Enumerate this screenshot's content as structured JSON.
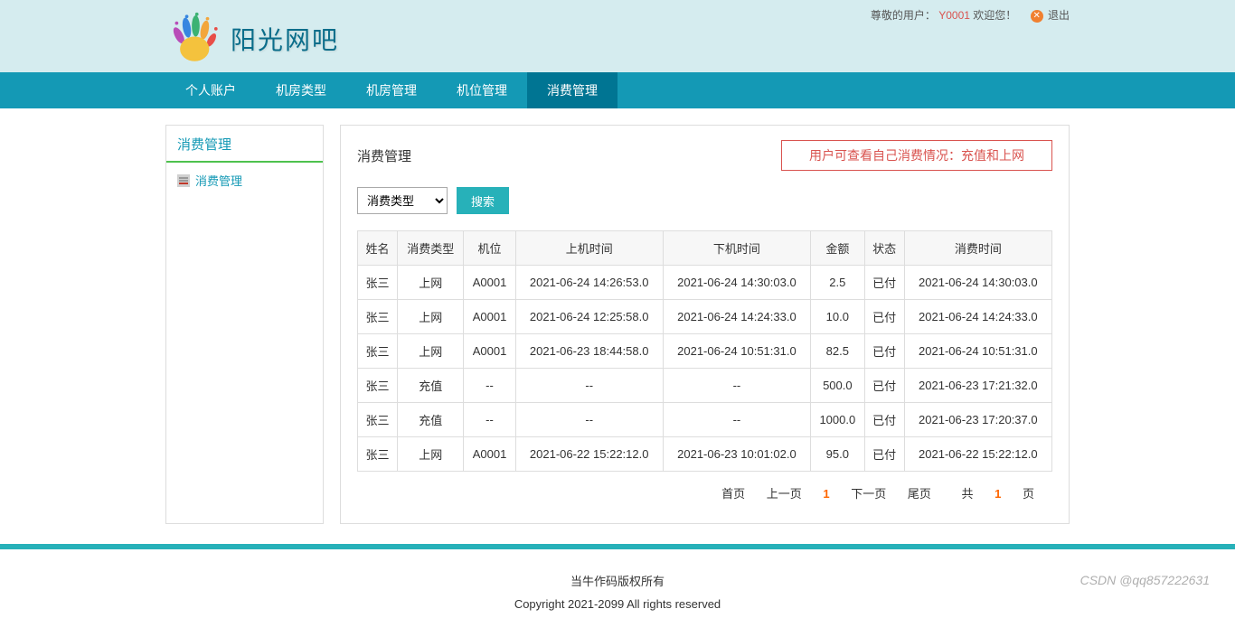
{
  "header": {
    "user_label": "尊敬的用户：",
    "username": "Y0001",
    "welcome": " 欢迎您！",
    "logout": "退出",
    "site_title": "阳光网吧"
  },
  "nav": {
    "items": [
      {
        "label": "个人账户"
      },
      {
        "label": "机房类型"
      },
      {
        "label": "机房管理"
      },
      {
        "label": "机位管理"
      },
      {
        "label": "消费管理",
        "active": true
      }
    ]
  },
  "sidebar": {
    "title": "消费管理",
    "items": [
      {
        "label": "消费管理"
      }
    ]
  },
  "content": {
    "title": "消费管理",
    "notice": "用户可查看自己消费情况：充值和上网",
    "select_placeholder": "消费类型",
    "search_btn": "搜索"
  },
  "table": {
    "headers": [
      "姓名",
      "消费类型",
      "机位",
      "上机时间",
      "下机时间",
      "金额",
      "状态",
      "消费时间"
    ],
    "rows": [
      [
        "张三",
        "上网",
        "A0001",
        "2021-06-24 14:26:53.0",
        "2021-06-24 14:30:03.0",
        "2.5",
        "已付",
        "2021-06-24 14:30:03.0"
      ],
      [
        "张三",
        "上网",
        "A0001",
        "2021-06-24 12:25:58.0",
        "2021-06-24 14:24:33.0",
        "10.0",
        "已付",
        "2021-06-24 14:24:33.0"
      ],
      [
        "张三",
        "上网",
        "A0001",
        "2021-06-23 18:44:58.0",
        "2021-06-24 10:51:31.0",
        "82.5",
        "已付",
        "2021-06-24 10:51:31.0"
      ],
      [
        "张三",
        "充值",
        "--",
        "--",
        "--",
        "500.0",
        "已付",
        "2021-06-23 17:21:32.0"
      ],
      [
        "张三",
        "充值",
        "--",
        "--",
        "--",
        "1000.0",
        "已付",
        "2021-06-23 17:20:37.0"
      ],
      [
        "张三",
        "上网",
        "A0001",
        "2021-06-22 15:22:12.0",
        "2021-06-23 10:01:02.0",
        "95.0",
        "已付",
        "2021-06-22 15:22:12.0"
      ]
    ]
  },
  "pagination": {
    "first": "首页",
    "prev": "上一页",
    "current": "1",
    "next": "下一页",
    "last": "尾页",
    "total_prefix": "共 ",
    "total_num": "1",
    "total_suffix": " 页"
  },
  "footer": {
    "line1": "当牛作码版权所有",
    "line2": "Copyright 2021-2099 All rights reserved"
  },
  "watermark": "CSDN @qq857222631"
}
